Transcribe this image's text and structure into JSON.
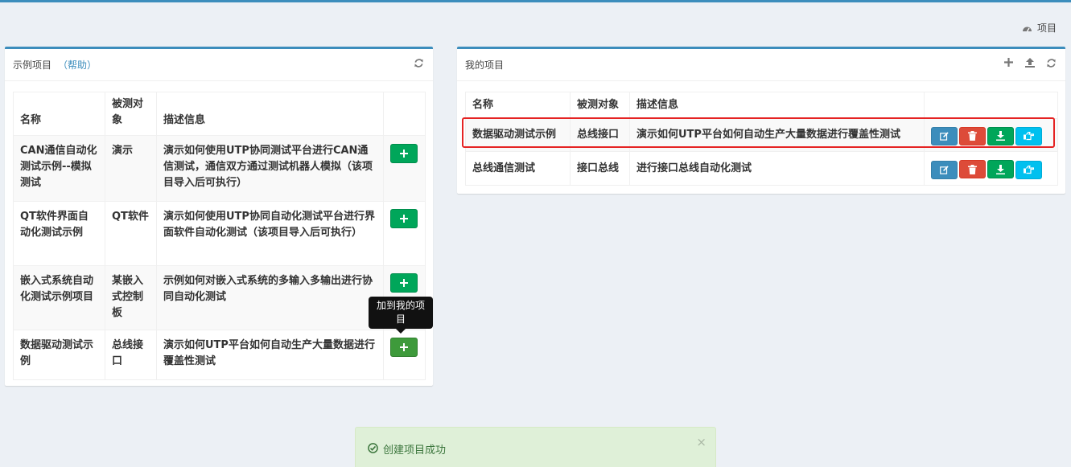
{
  "breadcrumb": {
    "label": "项目"
  },
  "examples": {
    "title": "示例项目",
    "help_label": "（帮助）",
    "headers": {
      "name": "名称",
      "target": "被测对象",
      "desc": "描述信息"
    },
    "rows": [
      {
        "name": "CAN通信自动化测试示例--模拟测试",
        "target": "演示",
        "desc": "演示如何使用UTP协同测试平台进行CAN通信测试，通信双方通过测试机器人模拟（该项目导入后可执行）"
      },
      {
        "name": "QT软件界面自动化测试示例",
        "target": "QT软件",
        "desc": "演示如何使用UTP协同自动化测试平台进行界面软件自动化测试（该项目导入后可执行）"
      },
      {
        "name": "嵌入式系统自动化测试示例项目",
        "target": "某嵌入式控制板",
        "desc": "示例如何对嵌入式系统的多输入多输出进行协同自动化测试"
      },
      {
        "name": "数据驱动测试示例",
        "target": "总线接口",
        "desc": "演示如何UTP平台如何自动生产大量数据进行覆盖性测试"
      }
    ],
    "tooltip": "加到我的项目"
  },
  "my_projects": {
    "title": "我的项目",
    "headers": {
      "name": "名称",
      "target": "被测对象",
      "desc": "描述信息"
    },
    "rows": [
      {
        "name": "数据驱动测试示例",
        "target": "总线接口",
        "desc": "演示如何UTP平台如何自动生产大量数据进行覆盖性测试"
      },
      {
        "name": "总线通信测试",
        "target": "接口总线",
        "desc": "进行接口总线自动化测试"
      }
    ]
  },
  "alert": {
    "message": "创建项目成功",
    "close": "×"
  }
}
